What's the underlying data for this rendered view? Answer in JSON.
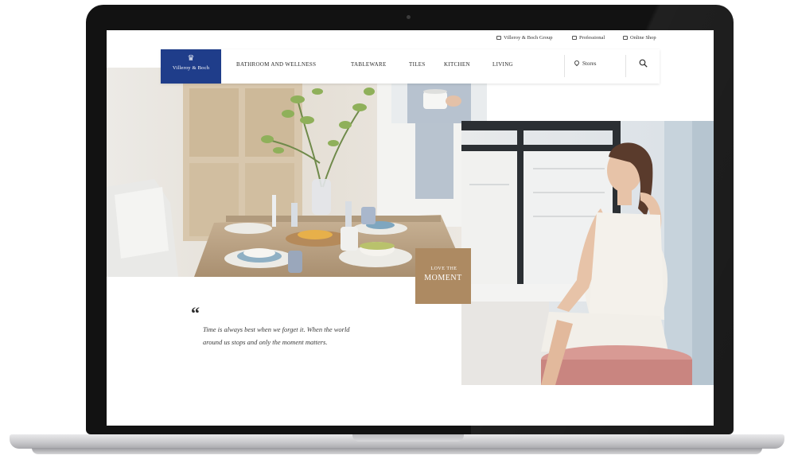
{
  "utility_links": [
    "Villeroy & Boch Group",
    "Professional",
    "Online Shop"
  ],
  "logo": {
    "wordmark": "Villeroy & Boch",
    "icon": "crest-icon"
  },
  "nav": [
    "BATHROOM AND WELLNESS",
    "TABLEWARE",
    "TILES",
    "KITCHEN",
    "LIVING"
  ],
  "location": {
    "label": "Stores",
    "icon": "map-pin-icon"
  },
  "search": {
    "icon": "search-icon"
  },
  "hero": {
    "badge_line1": "LOVE",
    "badge_small": "THE",
    "badge_line2": "MOMENT"
  },
  "quote": {
    "mark": "“",
    "text": "Time is always best when we forget it. When the world around us stops and only the moment matters."
  },
  "colors": {
    "brand_blue": "#1f3d8a",
    "badge_tan": "#ad8a62",
    "bezel": "#121212"
  }
}
